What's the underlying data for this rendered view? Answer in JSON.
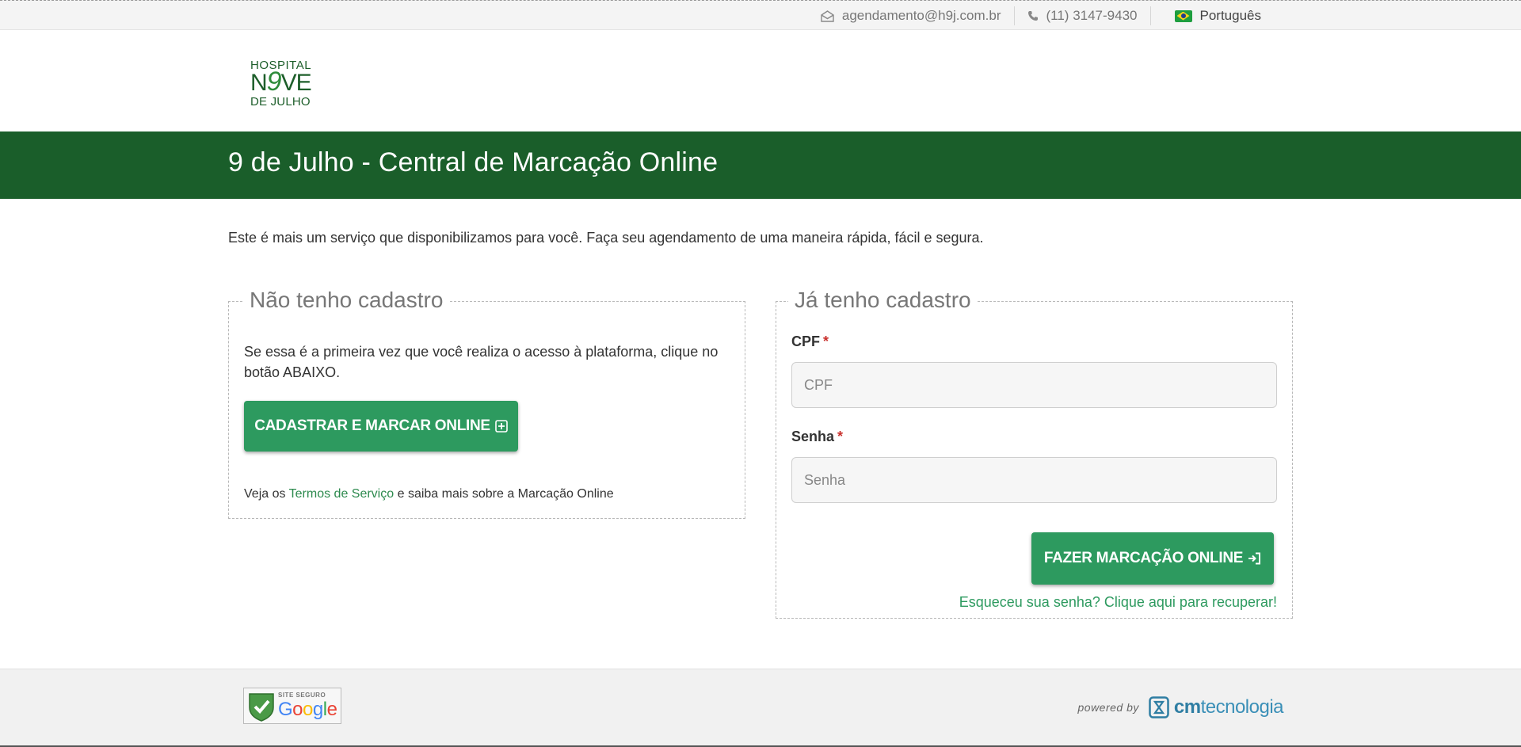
{
  "topbar": {
    "email": "agendamento@h9j.com.br",
    "phone": "(11) 3147-9430",
    "language": "Português",
    "icons": [
      "envelope-icon",
      "phone-icon",
      "brazil-flag-icon"
    ]
  },
  "logo": {
    "line1": "HOSPITAL",
    "line2_pre": "N",
    "line2_nine": "9",
    "line2_post": "VE",
    "line3": "DE JULHO"
  },
  "band": {
    "title": "9 de Julho - Central de Marcação Online"
  },
  "intro": "Este é mais um serviço que disponibilizamos para você. Faça seu agendamento de uma maneira rápida, fácil e segura.",
  "register_panel": {
    "legend": "Não tenho cadastro",
    "description": "Se essa é a primeira vez que você realiza o acesso à plataforma, clique no botão ABAIXO.",
    "button_label": "CADASTRAR E MARCAR ONLINE",
    "terms_prefix": "Veja os",
    "terms_link": "Termos de Serviço",
    "terms_suffix": "e saiba mais sobre a Marcação Online"
  },
  "login_panel": {
    "legend": "Já tenho cadastro",
    "cpf_label": "CPF",
    "cpf_placeholder": "CPF",
    "cpf_value": "",
    "password_label": "Senha",
    "password_placeholder": "Senha",
    "password_value": "",
    "required_mark": "*",
    "button_label": "FAZER MARCAÇÃO ONLINE",
    "forgot_link": "Esqueceu sua senha? Clique aqui para recuperar!"
  },
  "footer": {
    "seal_top": "SITE SEGURO",
    "seal_g1": "G",
    "seal_g2": "o",
    "seal_g3": "o",
    "seal_g4": "g",
    "seal_g5": "l",
    "seal_g6": "e",
    "powered_by": "powered by",
    "brand_cm": "cm",
    "brand_rest": "tecnologia"
  },
  "colors": {
    "band": "#1a5e2a",
    "button": "#2d9a5f",
    "link": "#2d8a4e",
    "required": "#c9302c"
  }
}
